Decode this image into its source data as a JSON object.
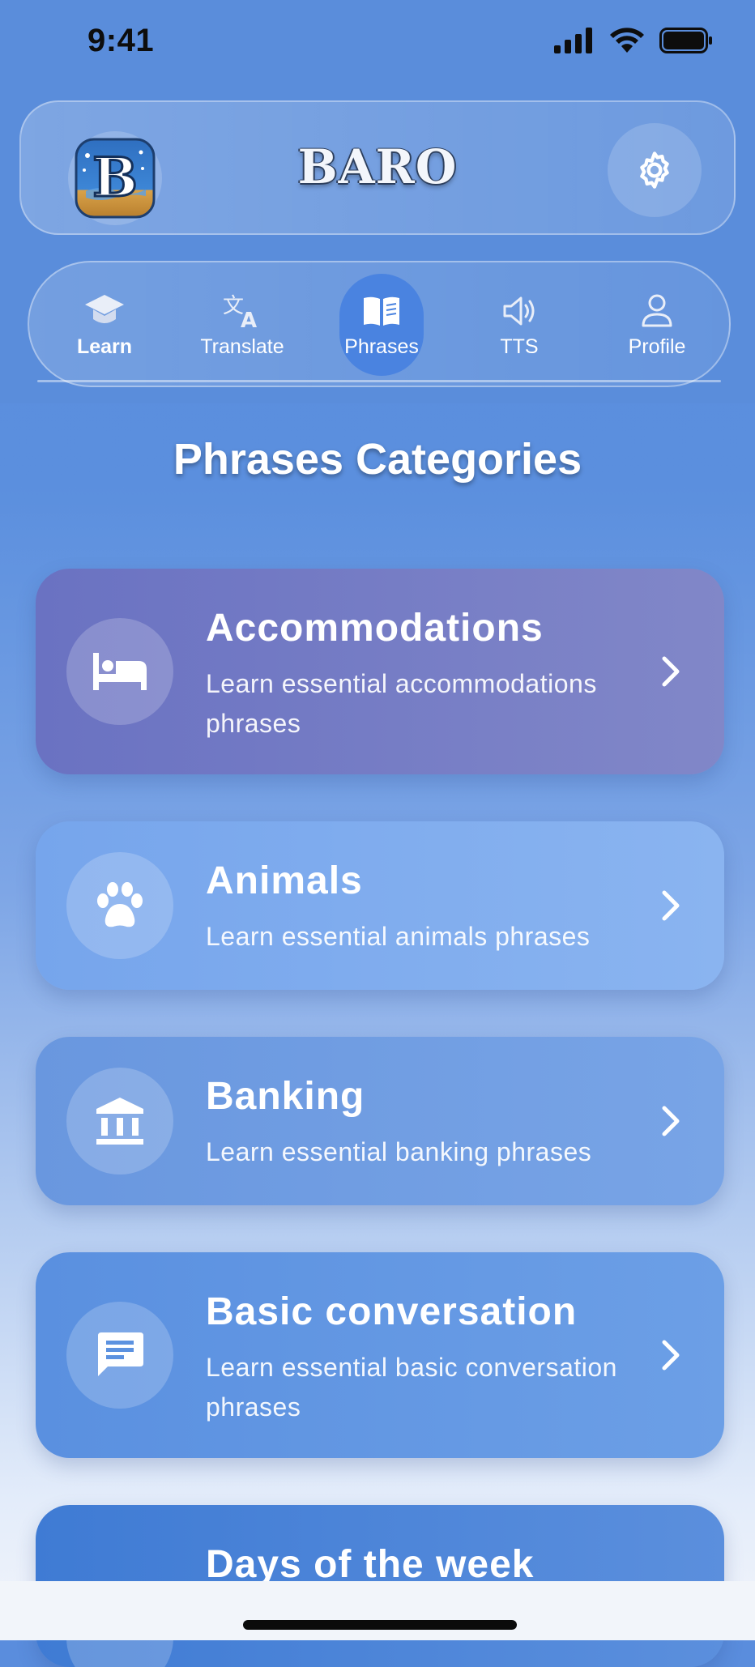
{
  "status_bar": {
    "time": "9:41"
  },
  "header": {
    "title": "BARO",
    "logo_letter": "B"
  },
  "tabs": [
    {
      "label": "Learn",
      "icon": "graduation-cap-icon",
      "active": false
    },
    {
      "label": "Translate",
      "icon": "translate-icon",
      "active": false
    },
    {
      "label": "Phrases",
      "icon": "book-open-icon",
      "active": true
    },
    {
      "label": "TTS",
      "icon": "speaker-icon",
      "active": false
    },
    {
      "label": "Profile",
      "icon": "user-icon",
      "active": false
    }
  ],
  "page": {
    "title": "Phrases Categories"
  },
  "categories": [
    {
      "title": "Accommodations",
      "description": "Learn essential accommodations phrases",
      "icon": "bed-icon",
      "color": "#7378c6"
    },
    {
      "title": "Animals",
      "description": "Learn essential animals phrases",
      "icon": "paw-icon",
      "color": "#7aa9ec"
    },
    {
      "title": "Banking",
      "description": "Learn essential banking phrases",
      "icon": "bank-icon",
      "color": "#6f9be0"
    },
    {
      "title": "Basic conversation",
      "description": "Learn essential basic conversation phrases",
      "icon": "chat-icon",
      "color": "#5f96e2"
    },
    {
      "title": "Days of the week",
      "description": "",
      "icon": "calendar-icon",
      "color": "#4a80d6"
    }
  ],
  "colors": {
    "header_bg": "#5a8ddb",
    "active_tab": "#4a83e0"
  }
}
